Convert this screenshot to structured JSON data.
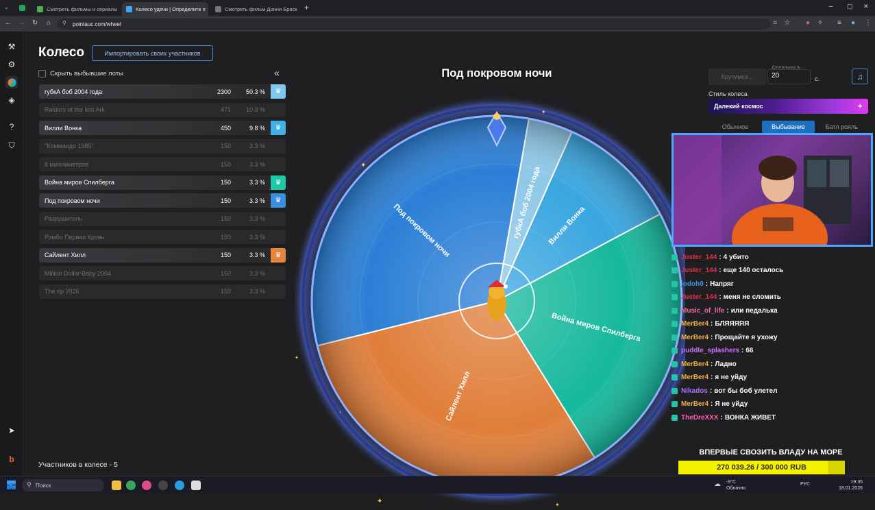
{
  "browser": {
    "tabs": [
      {
        "title": "Смотреть фильмы и сериалы",
        "active": false,
        "favicon_color": "#4caf50"
      },
      {
        "title": "Колесо удачи | Определите п",
        "active": true,
        "favicon_color": "#3fa7ff"
      },
      {
        "title": "Смотреть фильм Донни Браск",
        "active": false,
        "favicon_color": "#777777"
      }
    ],
    "url": "pointauc.com/wheel"
  },
  "header": {
    "title": "Колесо",
    "import_button": "Импортировать своих участников"
  },
  "options": {
    "hide_dropped_label": "Скрыть выбывшие лоты",
    "collapse_icon": "«"
  },
  "lots": [
    {
      "name": "губкА боб 2004 года",
      "amount": "2300",
      "percent": "50.3 %",
      "active": true,
      "color": "#7fc6f0"
    },
    {
      "name": "Raiders of the lost Ark",
      "amount": "471",
      "percent": "10.3 %",
      "active": false
    },
    {
      "name": "Вилли Вонка",
      "amount": "450",
      "percent": "9.8 %",
      "active": true,
      "color": "#3fb0e8"
    },
    {
      "name": "\"Коммандо 1985\"",
      "amount": "150",
      "percent": "3.3 %",
      "active": false
    },
    {
      "name": "8 миллиметров",
      "amount": "150",
      "percent": "3.3 %",
      "active": false
    },
    {
      "name": "Война миров Спилберга",
      "amount": "150",
      "percent": "3.3 %",
      "active": true,
      "color": "#1ec9a7"
    },
    {
      "name": "Под покровом ночи",
      "amount": "150",
      "percent": "3.3 %",
      "active": true,
      "color": "#3a8fe0"
    },
    {
      "name": "Разрушитель",
      "amount": "150",
      "percent": "3.3 %",
      "active": false
    },
    {
      "name": "Рэмбо Первая Кровь",
      "amount": "150",
      "percent": "3.3 %",
      "active": false
    },
    {
      "name": "Сайлент Хилл",
      "amount": "150",
      "percent": "3.3 %",
      "active": true,
      "color": "#e8853a"
    },
    {
      "name": "Million Dollar Baby 2004",
      "amount": "150",
      "percent": "3.3 %",
      "active": false
    },
    {
      "name": "The rip 2026",
      "amount": "150",
      "percent": "3.3 %",
      "active": false
    }
  ],
  "participants_count": "Участников в колесе - 5",
  "wheel": {
    "current": "Под покровом ночи",
    "segments": [
      {
        "label": "губкА боб 2004 года",
        "color": "#8fc8e8"
      },
      {
        "label": "Вилли Вонка",
        "color": "#3aa6e0"
      },
      {
        "label": "Война миров Спилберга",
        "color": "#16b89c"
      },
      {
        "label": "Сайлент Хилл",
        "color": "#e07e3a"
      },
      {
        "label": "Под покровом ночи",
        "color": "#2b7fd6"
      }
    ]
  },
  "controls": {
    "spin_button": "Крутимся...",
    "duration_label": "Длительность",
    "duration_value": "20",
    "duration_unit": "с.",
    "style_label": "Стиль колеса",
    "style_value": "Далекий космос",
    "modes": [
      "Обычное",
      "Выбывание",
      "Батл рояль"
    ],
    "active_mode": "Выбывание"
  },
  "chat": [
    {
      "user": "Juster_144",
      "color": "#e0304a",
      "text": "4 убито"
    },
    {
      "user": "Juster_144",
      "color": "#e0304a",
      "text": "еще 140 осталось"
    },
    {
      "user": "jodoh8",
      "color": "#3a8fe0",
      "text": "Напряг"
    },
    {
      "user": "Juster_144",
      "color": "#e0304a",
      "text": "меня не сломить"
    },
    {
      "user": "Music_of_life",
      "color": "#f06aa0",
      "text": "или педалька"
    },
    {
      "user": "MerBer4",
      "color": "#f0b040",
      "text": "БЛЯЯЯЯЯ"
    },
    {
      "user": "MerBer4",
      "color": "#f0b040",
      "text": "Прощайте я ухожу"
    },
    {
      "user": "puddle_splashers",
      "color": "#d070ff",
      "text": "66"
    },
    {
      "user": "MerBer4",
      "color": "#f0b040",
      "text": "Ладно"
    },
    {
      "user": "MerBer4",
      "color": "#f0b040",
      "text": "я не уйду"
    },
    {
      "user": "Nikados",
      "color": "#b070ff",
      "text": "вот бы боб улетел"
    },
    {
      "user": "MerBer4",
      "color": "#f0b040",
      "text": "Я не уйду"
    },
    {
      "user": "TheDreXXX",
      "color": "#ff5ab0",
      "text": "ВОНКА ЖИВЕТ"
    }
  ],
  "stream": {
    "title": "ВПЕРВЫЕ СВОЗИТЬ ВЛАДУ НА МОРЕ",
    "goal": "270 039.26 / 300 000 RUB",
    "goal_fraction": 0.9
  },
  "taskbar": {
    "search": "Поиск",
    "weather": "-9°C",
    "weather_desc": "Облачно",
    "lang": "РУС",
    "time": "19:35",
    "date": "18.01.2026"
  }
}
